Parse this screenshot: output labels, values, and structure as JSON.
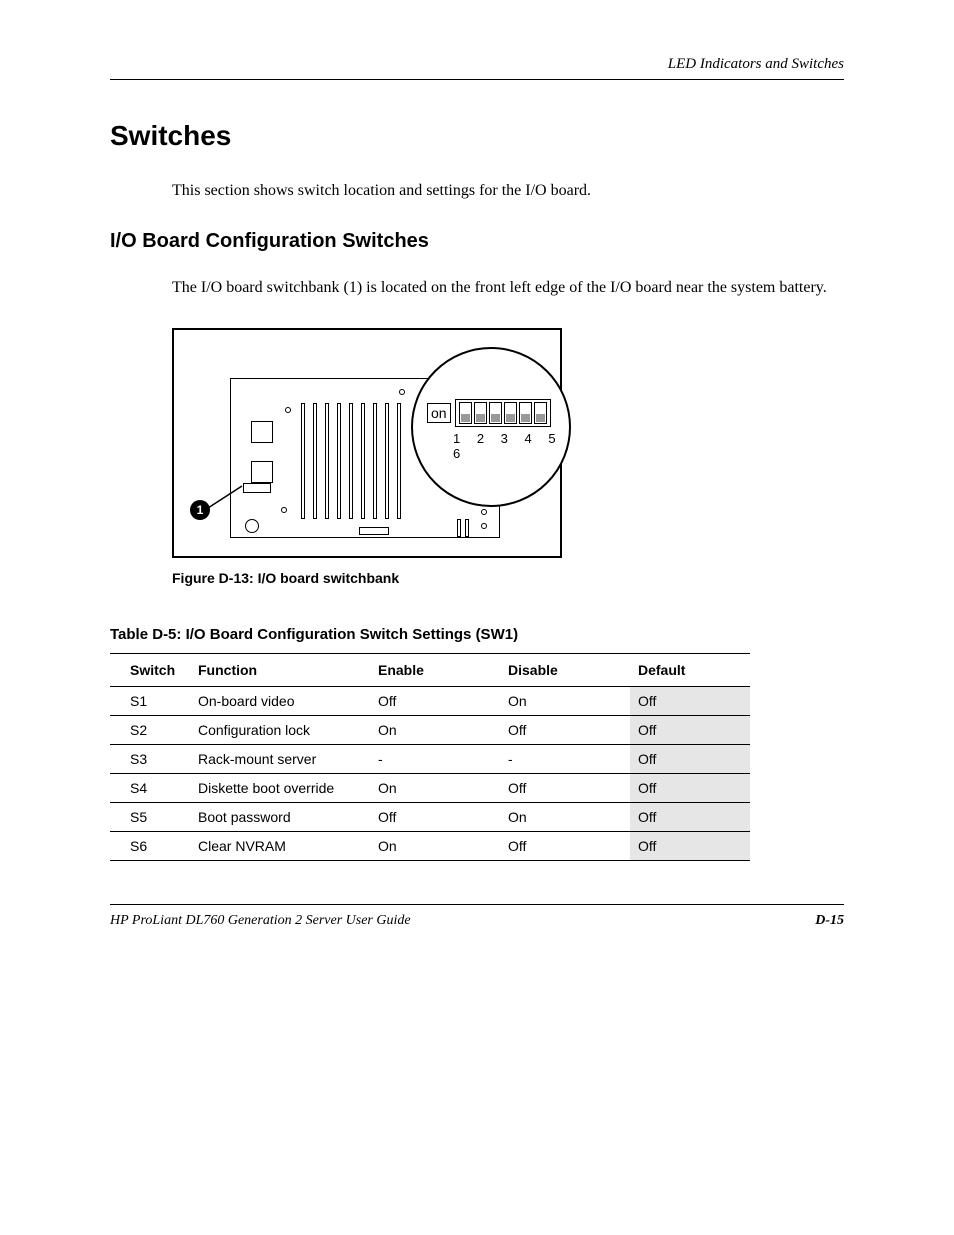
{
  "header": {
    "chapter": "LED Indicators and Switches"
  },
  "h1": "Switches",
  "intro": "This section shows switch location and settings for the I/O board.",
  "h2": "I/O Board Configuration Switches",
  "section_text": "The I/O board switchbank (1) is located on the front left edge of the I/O board near the system battery.",
  "figure": {
    "callout_on": "on",
    "dip_numbers": "1 2 3 4 5 6",
    "badge": "1",
    "caption": "Figure D-13:  I/O board switchbank"
  },
  "table": {
    "caption": "Table D-5:  I/O Board Configuration Switch Settings (SW1)",
    "headers": [
      "Switch",
      "Function",
      "Enable",
      "Disable",
      "Default"
    ],
    "rows": [
      {
        "c0": "S1",
        "c1": "On-board video",
        "c2": "Off",
        "c3": "On",
        "c4": "Off"
      },
      {
        "c0": "S2",
        "c1": "Configuration lock",
        "c2": "On",
        "c3": "Off",
        "c4": "Off"
      },
      {
        "c0": "S3",
        "c1": "Rack-mount server",
        "c2": "-",
        "c3": "-",
        "c4": "Off"
      },
      {
        "c0": "S4",
        "c1": "Diskette boot override",
        "c2": "On",
        "c3": "Off",
        "c4": "Off"
      },
      {
        "c0": "S5",
        "c1": "Boot password",
        "c2": "Off",
        "c3": "On",
        "c4": "Off"
      },
      {
        "c0": "S6",
        "c1": "Clear NVRAM",
        "c2": "On",
        "c3": "Off",
        "c4": "Off"
      }
    ]
  },
  "footer": {
    "guide": "HP ProLiant DL760 Generation 2 Server User Guide",
    "page": "D-15"
  }
}
